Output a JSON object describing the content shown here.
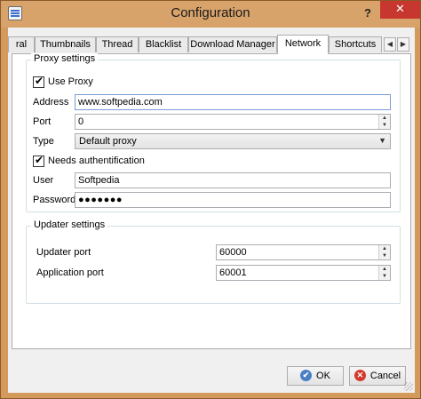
{
  "window": {
    "title": "Configuration",
    "help_button": "?",
    "close_button": "✕"
  },
  "tabs": [
    {
      "label": "ral"
    },
    {
      "label": "Thumbnails"
    },
    {
      "label": "Thread"
    },
    {
      "label": "Blacklist"
    },
    {
      "label": "Download Manager"
    },
    {
      "label": "Network",
      "active": true
    },
    {
      "label": "Shortcuts"
    }
  ],
  "tab_scroll": {
    "left": "◀",
    "right": "▶"
  },
  "proxy": {
    "group_title": "Proxy settings",
    "use_proxy_label": "Use Proxy",
    "use_proxy_checked": true,
    "address_label": "Address",
    "address_value": "www.softpedia.com",
    "port_label": "Port",
    "port_value": "0",
    "type_label": "Type",
    "type_value": "Default proxy",
    "needs_auth_label": "Needs authentification",
    "needs_auth_checked": true,
    "user_label": "User",
    "user_value": "Softpedia",
    "password_label": "Password",
    "password_value": "●●●●●●●"
  },
  "updater": {
    "group_title": "Updater settings",
    "updater_port_label": "Updater port",
    "updater_port_value": "60000",
    "application_port_label": "Application port",
    "application_port_value": "60001"
  },
  "buttons": {
    "ok_label": "OK",
    "cancel_label": "Cancel"
  }
}
